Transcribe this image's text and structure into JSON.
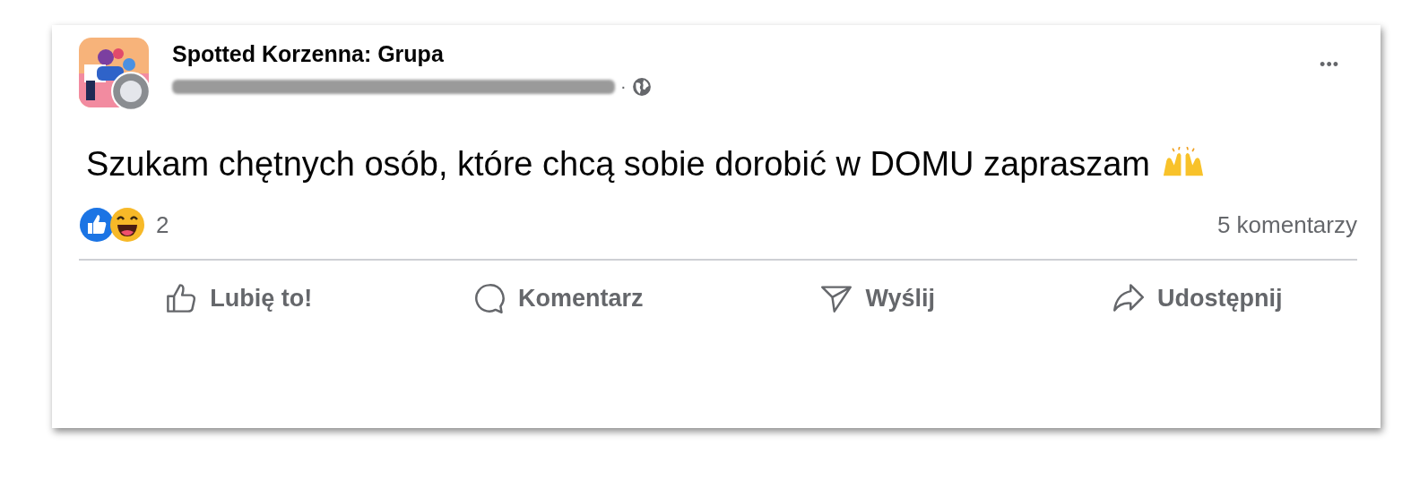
{
  "post": {
    "group_name": "Spotted Korzenna: Grupa",
    "separator": "·",
    "text": "Szukam chętnych osób, które chcą sobie dorobić w DOMU zapraszam",
    "more": "•••"
  },
  "reactions": {
    "count": "2",
    "comments": "5 komentarzy"
  },
  "actions": [
    {
      "kind": "like",
      "label": "Lubię to!"
    },
    {
      "kind": "comment",
      "label": "Komentarz"
    },
    {
      "kind": "send",
      "label": "Wyślij"
    },
    {
      "kind": "share",
      "label": "Udostępnij"
    }
  ]
}
